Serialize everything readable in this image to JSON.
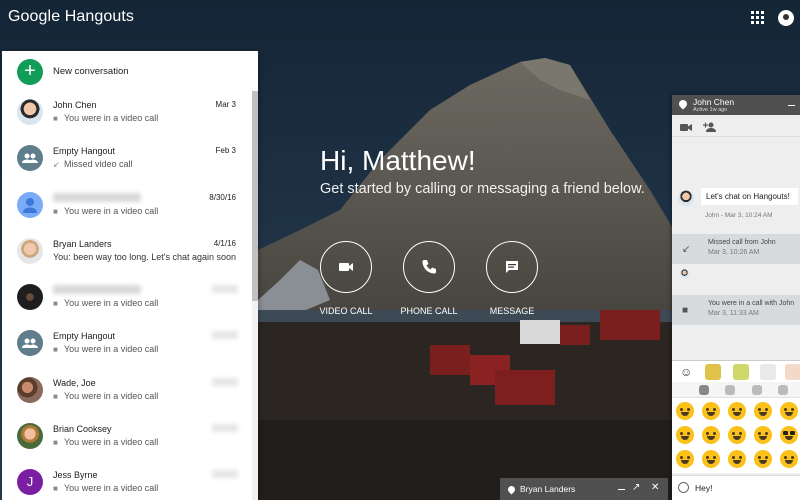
{
  "app": {
    "title": "Google Hangouts"
  },
  "topbar": {
    "apps_icon": "apps-grid-icon",
    "account_icon": "account-avatar-icon"
  },
  "sidebar": {
    "new_conversation_label": "New conversation",
    "conversations": [
      {
        "name": "John Chen",
        "date": "Mar 3",
        "preview": "You were in a video call",
        "preview_icon": "video-icon",
        "avatar": "photo"
      },
      {
        "name": "Empty Hangout",
        "date": "Feb 3",
        "preview": "Missed video call",
        "preview_icon": "missed-call-icon",
        "avatar": "group"
      },
      {
        "name": "",
        "date": "8/30/16",
        "preview": "You were in a video call",
        "preview_icon": "video-icon",
        "avatar": "default-person"
      },
      {
        "name": "Bryan Landers",
        "date": "4/1/16",
        "preview": "You: been way too long. Let's chat again soon",
        "preview_icon": "",
        "avatar": "photo"
      },
      {
        "name": "",
        "date": "",
        "preview": "You were in a video call",
        "preview_icon": "video-icon",
        "avatar": "photo"
      },
      {
        "name": "Empty Hangout",
        "date": "",
        "preview": "You were in a video call",
        "preview_icon": "video-icon",
        "avatar": "group"
      },
      {
        "name": "Wade, Joe",
        "date": "",
        "preview": "You were in a video call",
        "preview_icon": "video-icon",
        "avatar": "photo"
      },
      {
        "name": "Brian Cooksey",
        "date": "",
        "preview": "You were in a video call",
        "preview_icon": "video-icon",
        "avatar": "photo"
      },
      {
        "name": "Jess Byrne",
        "date": "",
        "preview": "You were in a video call",
        "preview_icon": "video-icon",
        "avatar": "letter",
        "initial": "J"
      }
    ]
  },
  "main": {
    "greeting": "Hi, Matthew!",
    "subtitle": "Get started by calling or messaging a friend below.",
    "actions": [
      {
        "label": "VIDEO CALL",
        "icon": "video-camera-icon"
      },
      {
        "label": "PHONE CALL",
        "icon": "phone-icon"
      },
      {
        "label": "MESSAGE",
        "icon": "message-icon"
      }
    ]
  },
  "chat": {
    "name": "John Chen",
    "status": "Active 1w ago",
    "messages": {
      "incoming_text": "Let's chat on Hangouts!",
      "incoming_meta": "John - Mar 3, 10:24 AM",
      "missed_title": "Missed call from John",
      "missed_time": "Mar 3, 10:26 AM",
      "call_title": "You were in a call with John",
      "call_time": "Mar 3, 11:33 AM"
    },
    "input_value": "Hey!"
  },
  "mini_chat": {
    "name": "Bryan Landers"
  },
  "colors": {
    "accent_green": "#0f9d58",
    "chat_header": "#505050",
    "emoji_yellow": "#fcc21b"
  }
}
